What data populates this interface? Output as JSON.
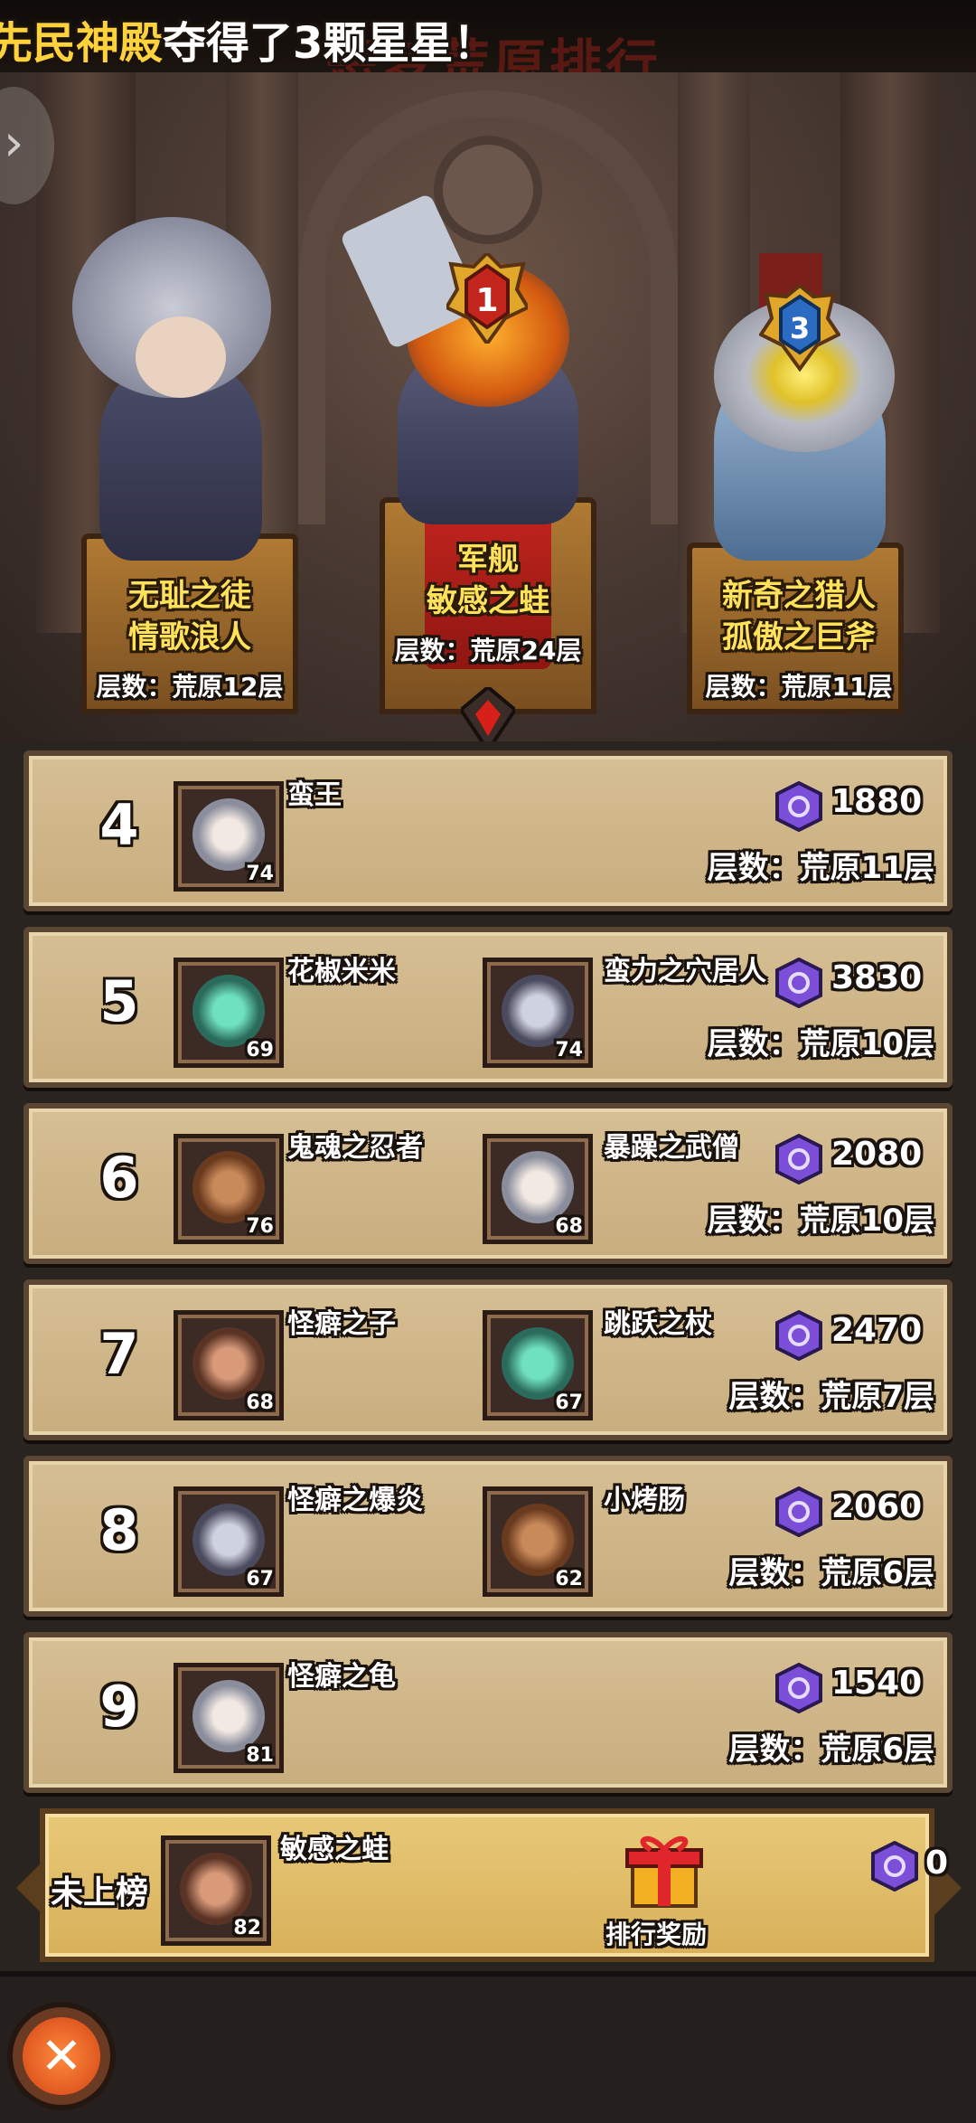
{
  "marquee": {
    "highlight": "先民神殿",
    "rest": "夺得了3颗星星！"
  },
  "page_title": "恶梦荒原排行",
  "podium": {
    "first": {
      "rank": "1",
      "title": "军舰",
      "name": "敏感之蛙",
      "floor": "层数：荒原24层"
    },
    "second": {
      "title": "无耻之徒",
      "name": "情歌浪人",
      "floor": "层数：荒原12层"
    },
    "third": {
      "rank": "3",
      "title": "新奇之猎人",
      "name": "孤傲之巨斧",
      "floor": "层数：荒原11层"
    }
  },
  "rows": [
    {
      "rank": "4",
      "members": [
        {
          "name": "蛮王",
          "level": "74"
        }
      ],
      "score": "1880",
      "floor": "层数：荒原11层"
    },
    {
      "rank": "5",
      "members": [
        {
          "name": "花椒米米",
          "level": "69"
        },
        {
          "name": "蛮力之穴居人",
          "level": "74"
        }
      ],
      "score": "3830",
      "floor": "层数：荒原10层"
    },
    {
      "rank": "6",
      "members": [
        {
          "name": "鬼魂之忍者",
          "level": "76"
        },
        {
          "name": "暴躁之武僧",
          "level": "68"
        }
      ],
      "score": "2080",
      "floor": "层数：荒原10层"
    },
    {
      "rank": "7",
      "members": [
        {
          "name": "怪癖之子",
          "level": "68"
        },
        {
          "name": "跳跃之杖",
          "level": "67"
        }
      ],
      "score": "2470",
      "floor": "层数：荒原7层"
    },
    {
      "rank": "8",
      "members": [
        {
          "name": "怪癖之爆炎",
          "level": "67"
        },
        {
          "name": "小烤肠",
          "level": "62"
        }
      ],
      "score": "2060",
      "floor": "层数：荒原6层"
    },
    {
      "rank": "9",
      "members": [
        {
          "name": "怪癖之龟",
          "level": "81"
        }
      ],
      "score": "1540",
      "floor": "层数：荒原6层"
    }
  ],
  "mine": {
    "rank_label": "未上榜",
    "name": "敏感之蛙",
    "level": "82",
    "reward_label": "排行奖励",
    "score": "0"
  },
  "icons": {
    "close": "close-icon",
    "gem": "rank-gem-icon",
    "gift": "gift-icon",
    "back": "chevron-left-icon"
  },
  "colors": {
    "card": "#d6bf94",
    "card_border": "#5b4634",
    "mine_card": "#e8c978",
    "accent_red": "#c7261f",
    "gem": "#7b4fd8"
  }
}
